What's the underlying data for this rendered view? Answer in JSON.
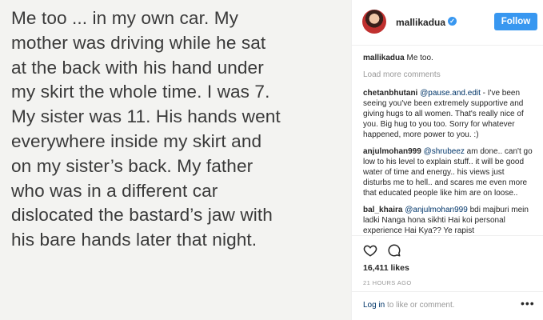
{
  "post": {
    "image_text_lines": [
      "Me too ... in my own car. My",
      "mother was driving while he sat",
      "at the back with his hand under",
      "my skirt the whole time. I was 7.",
      "My sister was 11. His hands went",
      "everywhere inside my skirt and",
      "on my sister’s back. My father",
      "who was in a different car",
      "dislocated the bastard’s jaw with",
      "his bare hands later that night."
    ]
  },
  "header": {
    "username": "mallikadua",
    "verified_icon": "verified-badge-icon",
    "follow_label": "Follow"
  },
  "caption": {
    "user": "mallikadua",
    "text": "Me too."
  },
  "load_more": "Load more comments",
  "comments": [
    {
      "user": "chetanbhutani",
      "mention": "@pause.and.edit",
      "text": "- I've been seeing you've been extremely supportive and giving hugs to all women. That's really nice of you. Big hug to you too. Sorry for whatever happened, more power to you. :)"
    },
    {
      "user": "anjulmohan999",
      "mention": "@shrubeez",
      "text": "am done.. can't go low to his level to explain stuff.. it will be good water of time and energy.. his views just disturbs me to hell.. and scares me even more that educated people like him are on loose.."
    },
    {
      "user": "bal_khaira",
      "mention": "@anjulmohan999",
      "text": "bdi majburi mein ladki Nanga hona sikhti Hai koi personal experience Hai Kya?? Ye rapist"
    }
  ],
  "actions": {
    "like_icon": "heart-icon",
    "comment_icon": "comment-icon",
    "likes": "16,411 likes",
    "time_ago": "21 HOURS AGO"
  },
  "footer": {
    "login_link": "Log in",
    "rest": " to like or comment.",
    "more_label": "•••"
  },
  "colors": {
    "accent": "#3897f0",
    "link": "#003569",
    "muted": "#999999",
    "image_bg": "#f3f3f1"
  }
}
